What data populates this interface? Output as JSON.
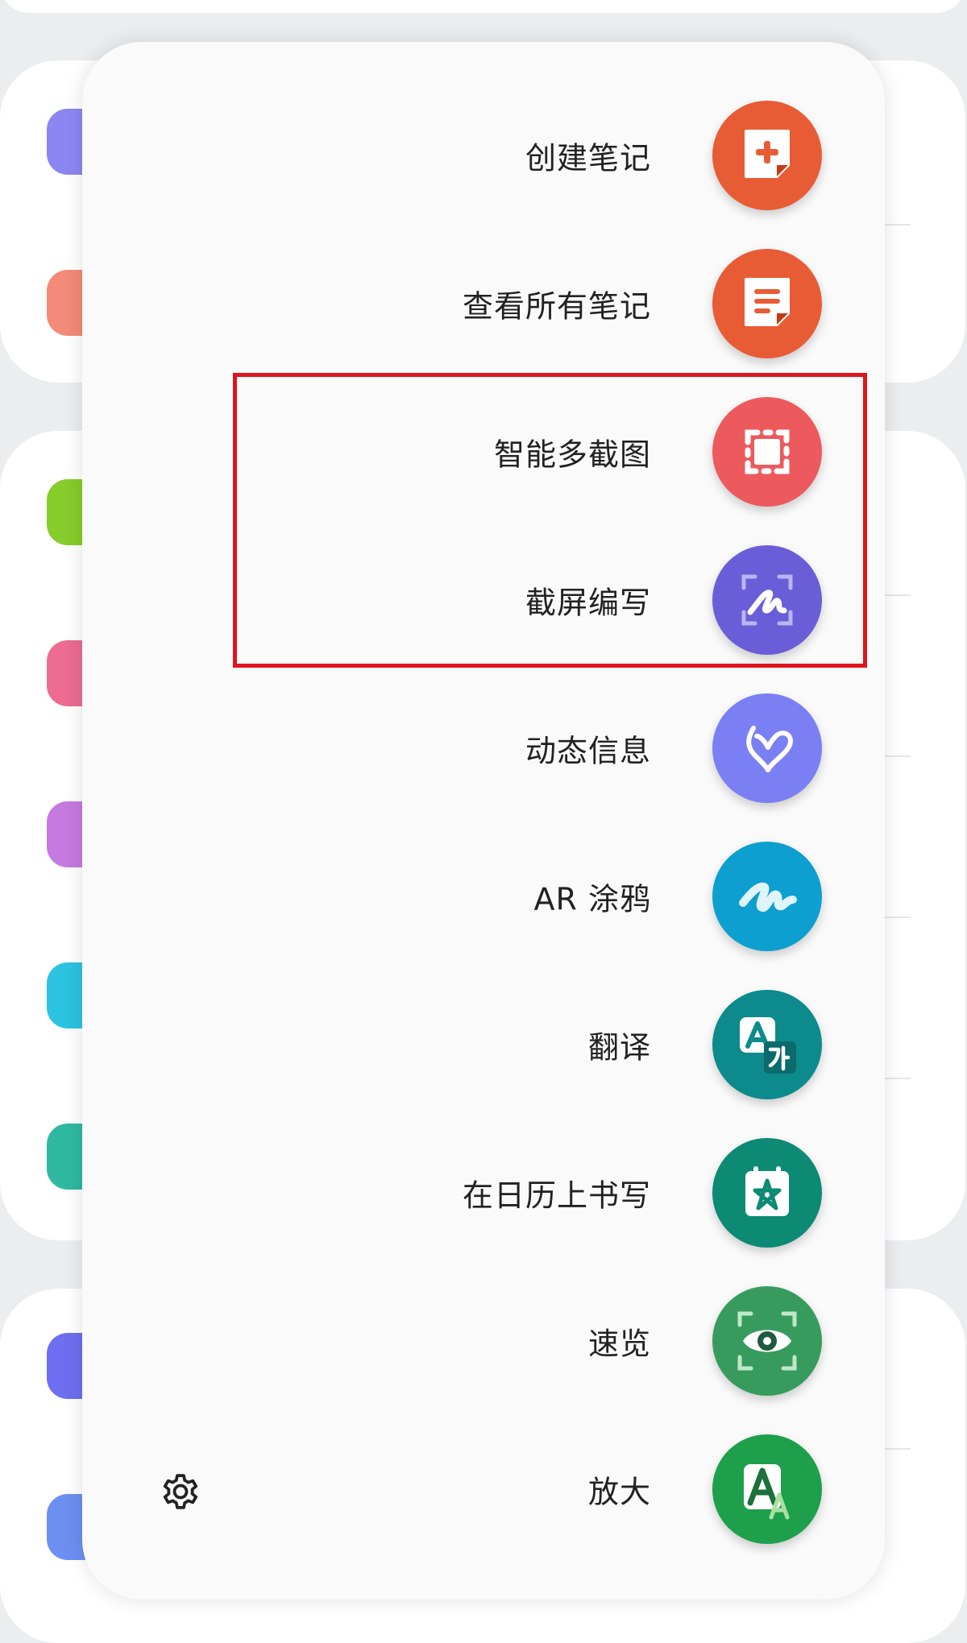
{
  "menu": {
    "items": [
      {
        "label": "创建笔记",
        "icon": "create-note-icon",
        "color": "#e85c35"
      },
      {
        "label": "查看所有笔记",
        "icon": "view-all-notes-icon",
        "color": "#e85c35"
      },
      {
        "label": "智能多截图",
        "icon": "smart-select-icon",
        "color": "#ec5a5d"
      },
      {
        "label": "截屏编写",
        "icon": "screen-write-icon",
        "color": "#6a5ed8"
      },
      {
        "label": "动态信息",
        "icon": "live-message-icon",
        "color": "#7a80f3"
      },
      {
        "label": "AR 涂鸦",
        "icon": "ar-doodle-icon",
        "color": "#0d9fd0"
      },
      {
        "label": "翻译",
        "icon": "translate-icon",
        "color": "#0d8a8c"
      },
      {
        "label": "在日历上书写",
        "icon": "write-on-calendar-icon",
        "color": "#0c8a73"
      },
      {
        "label": "速览",
        "icon": "glance-icon",
        "color": "#389b5e"
      },
      {
        "label": "放大",
        "icon": "magnify-icon",
        "color": "#1e9f4b"
      }
    ],
    "settings_icon": "gear-icon",
    "highlight_color": "#e0141c"
  }
}
